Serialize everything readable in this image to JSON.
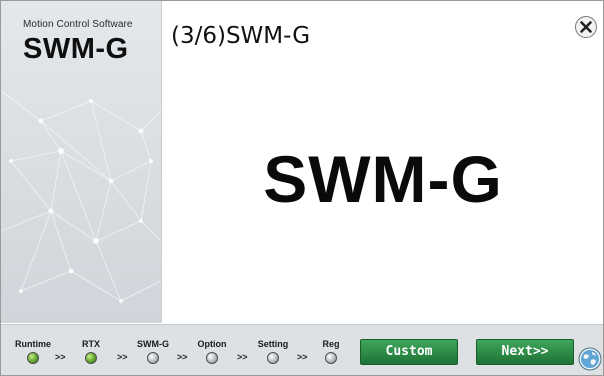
{
  "sidebar": {
    "subtitle": "Motion Control Software",
    "title": "SWM-G"
  },
  "header": {
    "step_title": "(3/6)SWM-G"
  },
  "main": {
    "big_title": "SWM-G"
  },
  "steps": [
    {
      "label": "Runtime",
      "status": "done"
    },
    {
      "label": "RTX",
      "status": "done"
    },
    {
      "label": "SWM-G",
      "status": "pending"
    },
    {
      "label": "Option",
      "status": "pending"
    },
    {
      "label": "Setting",
      "status": "pending"
    },
    {
      "label": "Reg",
      "status": "pending"
    }
  ],
  "step_separator": ">>",
  "buttons": {
    "custom_label": "Custom",
    "next_label": "Next>>"
  },
  "icons": {
    "close": "close-icon",
    "globe": "globe-icon"
  },
  "colors": {
    "button_green": "#2c8a46",
    "led_done": "#6fb33a",
    "led_pending": "#bfc3c6"
  }
}
